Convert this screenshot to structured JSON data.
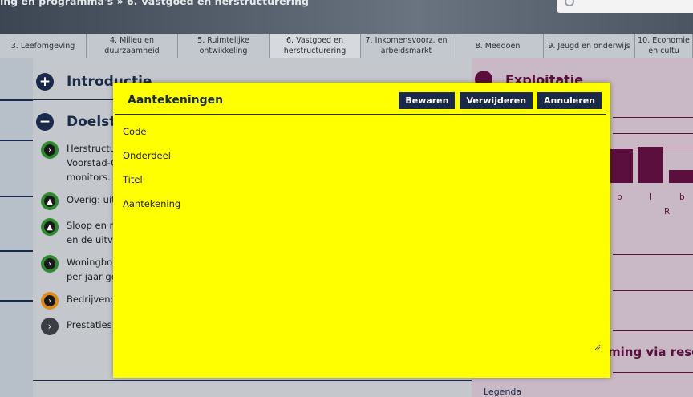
{
  "header": {
    "breadcrumb": "ing en programma's » 6. Vastgoed en herstructurering"
  },
  "tabs": [
    {
      "label": "3. Leefomgeving"
    },
    {
      "label": "4. Milieu en\nduurzaamheid"
    },
    {
      "label": "5. Ruimtelijke\nontwikkeling"
    },
    {
      "label": "6. Vastgoed en\nherstructurering"
    },
    {
      "label": "7. Inkomensvoorz. en\narbeidsmarkt"
    },
    {
      "label": "8. Meedoen"
    },
    {
      "label": "9. Jeugd en onderwijs"
    },
    {
      "label": "10. Economie\nen cultu"
    }
  ],
  "main": {
    "intro_title": "Introductie",
    "doel_title": "Doelste",
    "items": [
      {
        "lines": [
          "Herstructu",
          "Voorstad-O",
          "monitors."
        ]
      },
      {
        "lines": [
          "Overig: uit"
        ]
      },
      {
        "lines": [
          "Sloop en n",
          "en de uitve"
        ]
      },
      {
        "lines": [
          "Woningbou",
          "per jaar ge"
        ]
      },
      {
        "lines": [
          "Bedrijven:"
        ]
      },
      {
        "lines": [
          "Prestaties"
        ]
      }
    ]
  },
  "right": {
    "title": "Exploitatie",
    "labels": [
      "b",
      "l",
      "b"
    ],
    "r_label": "R",
    "bottom_title": "ming via rese",
    "legenda": "Legenda"
  },
  "modal": {
    "title": "Aantekeningen",
    "buttons": {
      "save": "Bewaren",
      "delete": "Verwijderen",
      "cancel": "Annuleren"
    },
    "fields": {
      "code": "Code",
      "onderdeel": "Onderdeel",
      "titel": "Titel",
      "aantekening": "Aantekening"
    }
  },
  "colors": {
    "navy": "#1b2a4a",
    "modal_bg": "#ffff00",
    "plum": "#5a0f3c"
  }
}
